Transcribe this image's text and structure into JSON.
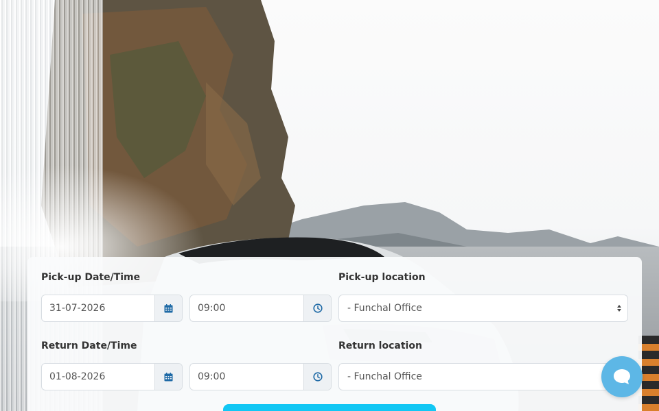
{
  "colors": {
    "accent": "#12c7f4",
    "chat_bubble": "#5db7e6",
    "icon_blue": "#1f6aa6"
  },
  "booking": {
    "pickup_datetime_label": "Pick-up Date/Time",
    "pickup_date_value": "31-07-2026",
    "pickup_time_value": "09:00",
    "pickup_location_label": "Pick-up location",
    "pickup_location_value": "- Funchal Office",
    "return_datetime_label": "Return Date/Time",
    "return_date_value": "01-08-2026",
    "return_time_value": "09:00",
    "return_location_label": "Return location",
    "return_location_value": "- Funchal Office"
  },
  "icons": {
    "calendar": "calendar-icon",
    "clock": "clock-icon",
    "select_arrows": "sort-arrows-icon",
    "chat": "chat-icon"
  }
}
